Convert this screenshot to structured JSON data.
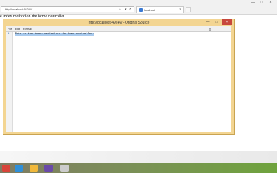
{
  "browser": {
    "address": "http://localhost:49246/",
    "tab_title": "localhost",
    "tab_close": "×",
    "window_minimize": "—",
    "window_maximize": "□",
    "window_close": "×"
  },
  "page": {
    "text": "e index method on the home controller"
  },
  "source_window": {
    "title": "http://localhost:49246/ - Original Source",
    "minimize": "—",
    "maximize": "□",
    "close": "×",
    "menu": [
      "File",
      "Edit",
      "Format"
    ],
    "line_number": "1",
    "line_text": "This is the index method on the home controller."
  },
  "taskbar": {
    "apps": [
      {
        "name": "chrome-icon",
        "color": "#d8443a"
      },
      {
        "name": "internet-explorer-icon",
        "color": "#2f8fd8"
      },
      {
        "name": "file-explorer-icon",
        "color": "#f0b83b"
      },
      {
        "name": "visual-studio-icon",
        "color": "#6a4aa8"
      },
      {
        "name": "app-icon",
        "color": "#cccccc"
      }
    ]
  }
}
